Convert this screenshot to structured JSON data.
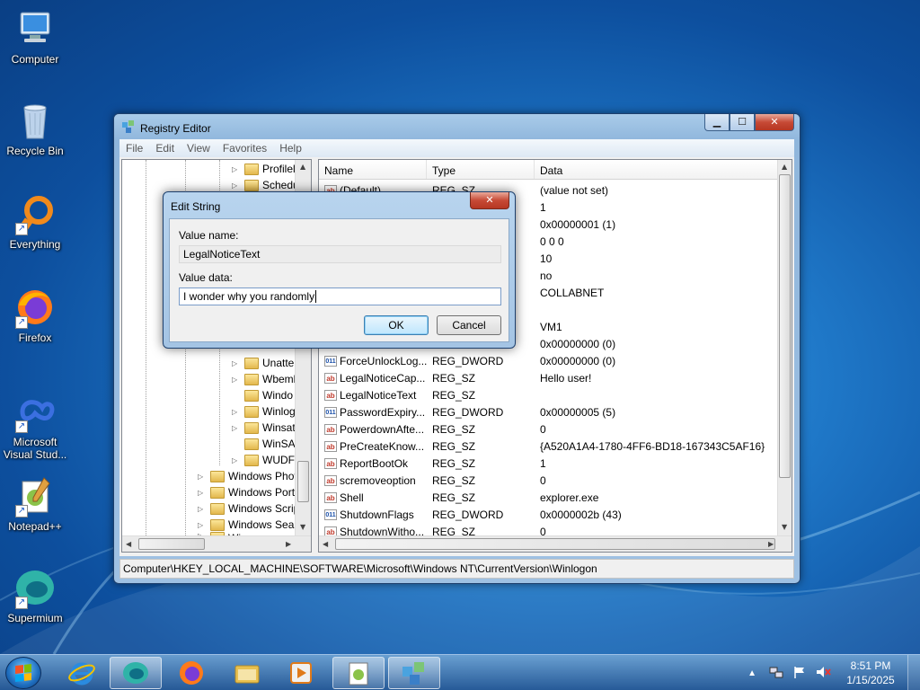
{
  "desktop": {
    "icons": [
      {
        "label": "Computer"
      },
      {
        "label": "Recycle Bin"
      },
      {
        "label": "Everything"
      },
      {
        "label": "Firefox"
      },
      {
        "label": "Microsoft Visual Stud..."
      },
      {
        "label": "Notepad++"
      },
      {
        "label": "Supermium"
      }
    ]
  },
  "regedit": {
    "title": "Registry Editor",
    "menu": [
      "File",
      "Edit",
      "View",
      "Favorites",
      "Help"
    ],
    "tree": [
      {
        "label": "Profilel",
        "indent": 3
      },
      {
        "label": "Schedu",
        "indent": 3
      },
      {
        "label": "Unatter",
        "indent": 3
      },
      {
        "label": "Wbeml",
        "indent": 3
      },
      {
        "label": "Windo",
        "indent": 3
      },
      {
        "label": "Winlog",
        "indent": 3
      },
      {
        "label": "Winsat",
        "indent": 3
      },
      {
        "label": "WinSAT",
        "indent": 3
      },
      {
        "label": "WUDF",
        "indent": 3
      },
      {
        "label": "Windows Phot",
        "indent": 2
      },
      {
        "label": "Windows Port",
        "indent": 2
      },
      {
        "label": "Windows Scrip",
        "indent": 2
      },
      {
        "label": "Windows Sear",
        "indent": 2
      },
      {
        "label": "Wisp",
        "indent": 2
      }
    ],
    "columns": {
      "name": "Name",
      "type": "Type",
      "data": "Data"
    },
    "rows": [
      {
        "name": "(Default)",
        "type": "REG_SZ",
        "data": "(value not set)",
        "icon": "ab"
      },
      {
        "name": "",
        "type": "",
        "data": "1",
        "icon": ""
      },
      {
        "name": "",
        "type": "",
        "data": "0x00000001 (1)",
        "icon": ""
      },
      {
        "name": "",
        "type": "",
        "data": "0 0 0",
        "icon": ""
      },
      {
        "name": "",
        "type": "",
        "data": "10",
        "icon": ""
      },
      {
        "name": "",
        "type": "",
        "data": "no",
        "icon": ""
      },
      {
        "name": "",
        "type": "",
        "data": "COLLABNET",
        "icon": ""
      },
      {
        "name": "",
        "type": "",
        "data": "",
        "icon": ""
      },
      {
        "name": "",
        "type": "",
        "data": "VM1",
        "icon": ""
      },
      {
        "name": "",
        "type": "",
        "data": "0x00000000 (0)",
        "icon": ""
      },
      {
        "name": "ForceUnlockLog...",
        "type": "REG_DWORD",
        "data": "0x00000000 (0)",
        "icon": "bin"
      },
      {
        "name": "LegalNoticeCap...",
        "type": "REG_SZ",
        "data": "Hello user!",
        "icon": "ab"
      },
      {
        "name": "LegalNoticeText",
        "type": "REG_SZ",
        "data": "",
        "icon": "ab"
      },
      {
        "name": "PasswordExpiry...",
        "type": "REG_DWORD",
        "data": "0x00000005 (5)",
        "icon": "bin"
      },
      {
        "name": "PowerdownAfte...",
        "type": "REG_SZ",
        "data": "0",
        "icon": "ab"
      },
      {
        "name": "PreCreateKnow...",
        "type": "REG_SZ",
        "data": "{A520A1A4-1780-4FF6-BD18-167343C5AF16}",
        "icon": "ab"
      },
      {
        "name": "ReportBootOk",
        "type": "REG_SZ",
        "data": "1",
        "icon": "ab"
      },
      {
        "name": "scremoveoption",
        "type": "REG_SZ",
        "data": "0",
        "icon": "ab"
      },
      {
        "name": "Shell",
        "type": "REG_SZ",
        "data": "explorer.exe",
        "icon": "ab"
      },
      {
        "name": "ShutdownFlags",
        "type": "REG_DWORD",
        "data": "0x0000002b (43)",
        "icon": "bin"
      },
      {
        "name": "ShutdownWitho...",
        "type": "REG_SZ",
        "data": "0",
        "icon": "ab"
      }
    ],
    "status_path": "Computer\\HKEY_LOCAL_MACHINE\\SOFTWARE\\Microsoft\\Windows NT\\CurrentVersion\\Winlogon"
  },
  "dialog": {
    "title": "Edit String",
    "value_name_label": "Value name:",
    "value_name": "LegalNoticeText",
    "value_data_label": "Value data:",
    "value_data": "I wonder why you randomly",
    "ok_label": "OK",
    "cancel_label": "Cancel"
  },
  "taskbar": {
    "time": "8:51 PM",
    "date": "1/15/2025"
  },
  "colors": {
    "desktop": "#1f78c8",
    "close_button": "#c74a36",
    "focus_button": "#3c7fb1"
  }
}
